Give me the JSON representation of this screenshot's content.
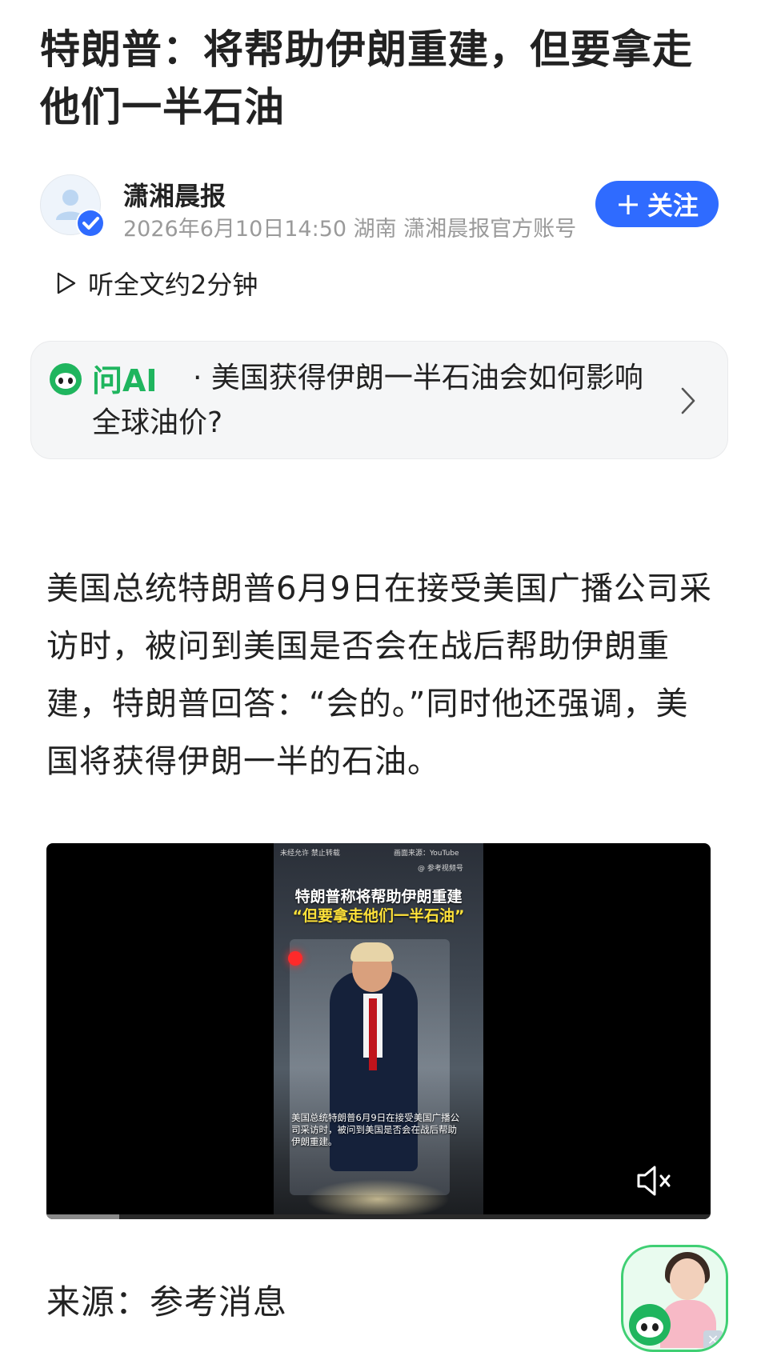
{
  "article": {
    "title": "特朗普：将帮助伊朗重建，但要拿走他们一半石油"
  },
  "author": {
    "name": "潇湘晨报",
    "meta": "2026年6月10日14:50 湖南 潇湘晨报官方账号",
    "follow_icon": "+",
    "follow_label": "关注"
  },
  "listen": {
    "label": "听全文约2分钟"
  },
  "ai_card": {
    "label": "问AI",
    "question": "· 美国获得伊朗一半石油会如何影响全球油价?"
  },
  "body": {
    "paragraph": "美国总统特朗普6月9日在接受美国广播公司采访时，被问到美国是否会在战后帮助伊朗重建，特朗普回答：“会的。”同时他还强调，美国将获得伊朗一半的石油。"
  },
  "video": {
    "top_left_note": "未经允许 禁止转载",
    "top_right_note": "画面来源：YouTube",
    "brand": "@ 参考视频号",
    "headline_line1": "特朗普称将帮助伊朗重建",
    "headline_line2": "“但要拿走他们一半石油”",
    "caption": "美国总统特朗普6月9日在接受美国广播公司采访时，被问到美国是否会在战后帮助伊朗重建。",
    "progress_fraction": 0.11,
    "muted": true
  },
  "source": {
    "label": "来源：参考消息"
  },
  "colors": {
    "accent": "#2f6bff",
    "ai_green": "#1fb55e",
    "meta_gray": "#9a9a9a"
  },
  "icons": [
    "verified-badge-icon",
    "play-icon",
    "ai-logo-icon",
    "chevron-right-icon",
    "mute-icon",
    "close-icon"
  ]
}
